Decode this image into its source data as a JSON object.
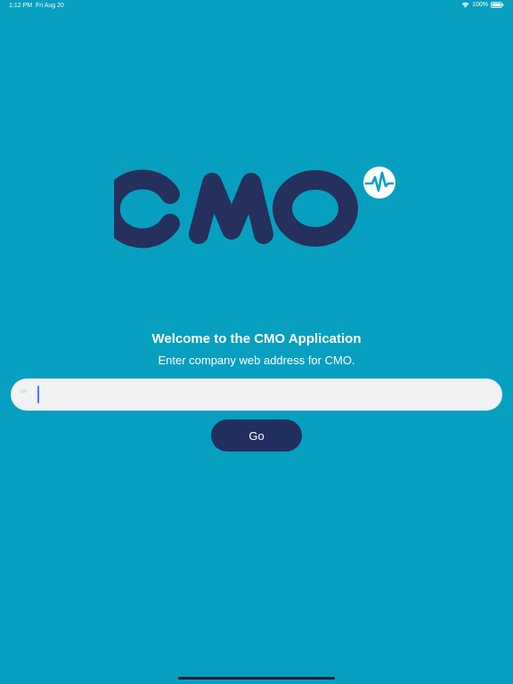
{
  "status_bar": {
    "time": "1:12 PM",
    "date": "Fri Aug 20",
    "battery": "100%",
    "icons": [
      "wifi-icon",
      "battery-icon"
    ]
  },
  "logo": {
    "text": "CMO",
    "badge_icon": "heartbeat-icon",
    "colors": {
      "letters": "#25305c",
      "badge_bg": "#ffffff",
      "badge_pulse": "#0a9fc1"
    }
  },
  "welcome": {
    "title": "Welcome to the CMO Application",
    "subtitle": "Enter company web address for CMO."
  },
  "url_field": {
    "icon_label": "url",
    "value": "",
    "placeholder": ""
  },
  "go_button": {
    "label": "Go"
  },
  "colors": {
    "background": "#079fc0",
    "button": "#232f5f",
    "field": "#f1f2f4",
    "caret": "#3d7cf5"
  }
}
